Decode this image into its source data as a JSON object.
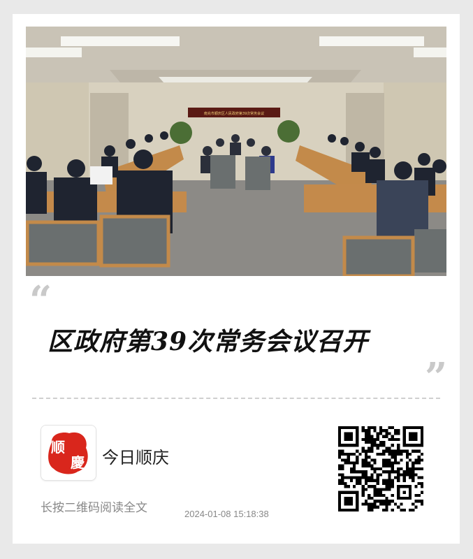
{
  "headline": "区政府第39次常务会议召开",
  "photo": {
    "banner_text": "南充市顺庆区人民政府第39次常务会议"
  },
  "source": {
    "name": "今日顺庆",
    "logo_chars": [
      "顺",
      "慶"
    ]
  },
  "hint": "长按二维码阅读全文",
  "timestamp": "2024-01-08 15:18:38",
  "colors": {
    "logo_red": "#d9261c",
    "background": "#e9e9e9",
    "card": "#ffffff"
  },
  "icons": {
    "quote_open": "“",
    "quote_close": "”",
    "qr": "qr-code-icon"
  }
}
